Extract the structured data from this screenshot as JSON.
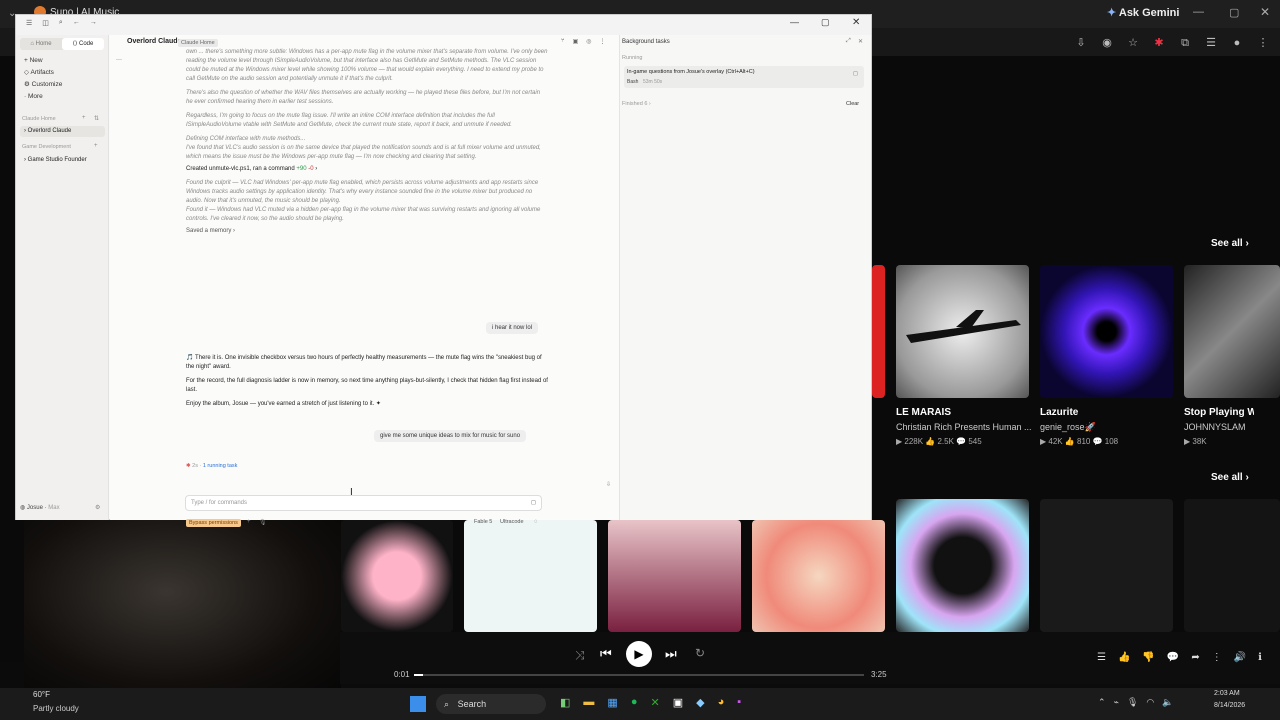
{
  "browser": {
    "tab_title": "Suno | AI Music",
    "ask_gemini": "Ask Gemini"
  },
  "app": {
    "tabs": {
      "home": "Home",
      "code": "Code"
    },
    "header_title": "Overlord Claude",
    "header_badge": "Claude Home",
    "sidebar": {
      "items": [
        {
          "label": "New",
          "icon": "plus-icon"
        },
        {
          "label": "Artifacts",
          "icon": "artifacts-icon"
        },
        {
          "label": "Customize",
          "icon": "customize-icon"
        },
        {
          "label": "More",
          "icon": "more-icon"
        }
      ],
      "section1": "Claude Home",
      "section1_item": "Overlord Claude",
      "section2": "Game Development",
      "section2_item": "Game Studio Founder",
      "user_name": "Josue",
      "user_plan": "Max"
    },
    "chat": {
      "p0": "own ... there's something more subtle: Windows has a per-app mute flag in the volume mixer that's separate from volume. I've only been reading the volume level through ISimpleAudioVolume, but that interface also has GetMute and SetMute methods. The VLC session could be muted at the Windows mixer level while showing 100% volume — that would explain everything. I need to extend my probe to call GetMute on the audio session and potentially unmute it if that's the culprit.",
      "p1": "There's also the question of whether the WAV files themselves are actually working — he played these files before, but I'm not certain he ever confirmed hearing them in earlier test sessions.",
      "p2": "Regardless, I'm going to focus on the mute flag issue. I'll write an inline COM interface definition that includes the full ISimpleAudioVolume vtable with SetMute and GetMute, check the current mute state, report it back, and unmute if needed.",
      "p3_title": "Defining COM interface with mute methods...",
      "p3": "I've found that VLC's audio session is on the same device that played the notification sounds and is at full mixer volume and unmuted, which means the issue must be the Windows per-app mute flag — I'm now checking and clearing that setting.",
      "created": "Created unmute-vlc.ps1, ran a command",
      "diff_add": "+90",
      "diff_del": "-0",
      "p4": "Found the culprit — VLC had Windows' per-app mute flag enabled, which persists across volume adjustments and app restarts since Windows tracks audio settings by application identity. That's why every instance sounded fine in the volume mixer but produced no audio. Now that it's unmuted, the music should be playing.",
      "p5": "Found it — Windows had VLC muted via a hidden per-app flag in the volume mixer that was surviving restarts and ignoring all volume controls. I've cleared it now, so the audio should be playing.",
      "saved_memory": "Saved a memory",
      "user_msg1": "i hear it now lol",
      "reply1": "🎵 There it is. One invisible checkbox versus two hours of perfectly healthy measurements — the mute flag wins the \"sneakiest bug of the night\" award.",
      "reply2": "For the record, the full diagnosis ladder is now in memory, so next time anything plays-but-silently, I check that hidden flag first instead of last.",
      "reply3": "Enjoy the album, Josue — you've earned a stretch of just listening to it. ✦",
      "user_msg2": "give me some unique ideas to mix for music for suno",
      "status_time": "2s",
      "status_tasks": "1 running task",
      "input_placeholder": "Type / for commands",
      "bypass": "Bypass permissions",
      "model": "Fable 5",
      "effort": "Ultracode"
    },
    "bg_tasks": {
      "title": "Background tasks",
      "running_label": "Running",
      "task_title": "In-game questions from Josue's overlay (Ctrl+Alt+C)",
      "task_kind": "Bash",
      "task_time": "53m 50s",
      "finished_label": "Finished",
      "finished_count": "6",
      "clear": "Clear"
    }
  },
  "suno": {
    "see_all_1": "See all",
    "see_all_2": "See all",
    "cards": [
      {
        "title": "LE MARAIS",
        "sub": "Christian Rich Presents Human ...",
        "plays": "228K",
        "likes": "2.5K",
        "comments": "545"
      },
      {
        "title": "Lazurite",
        "sub": "genie_rose🚀",
        "plays": "42K",
        "likes": "810",
        "comments": "108"
      },
      {
        "title": "Stop Playing W",
        "sub": "JOHNNYSLAM",
        "plays": "38K",
        "likes": "",
        "comments": ""
      }
    ],
    "player": {
      "current": "0:01",
      "total": "3:25",
      "progress": 0.02
    }
  },
  "taskbar": {
    "weather_temp": "60°F",
    "weather": "Partly cloudy",
    "search": "Search",
    "time": "2:03 AM",
    "date": "8/14/2026"
  }
}
